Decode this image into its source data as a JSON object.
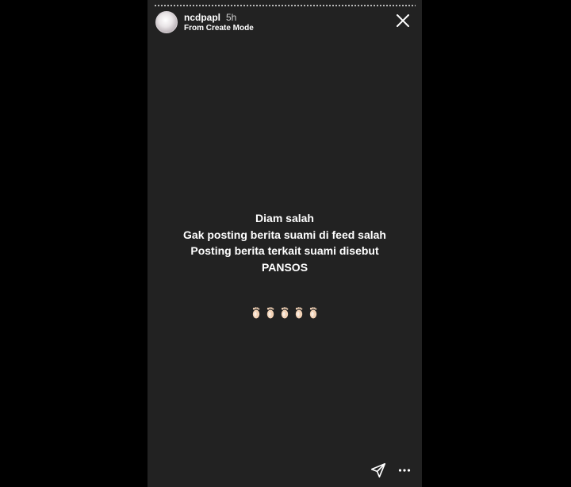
{
  "header": {
    "username": "ncdpapl",
    "time": "5h",
    "subtitle": "From Create Mode"
  },
  "caption": {
    "lines": [
      "Diam salah",
      "Gak posting berita suami di feed salah",
      "Posting berita terkait suami disebut",
      "PANSOS"
    ]
  },
  "emojis": [
    "foot-emoji",
    "foot-emoji",
    "foot-emoji",
    "foot-emoji",
    "foot-emoji"
  ],
  "colors": {
    "story_background": "#222222",
    "page_background": "#000000",
    "text": "#ffffff"
  },
  "icons": {
    "close": "close-icon",
    "send": "send-icon",
    "more": "more-options-icon"
  }
}
